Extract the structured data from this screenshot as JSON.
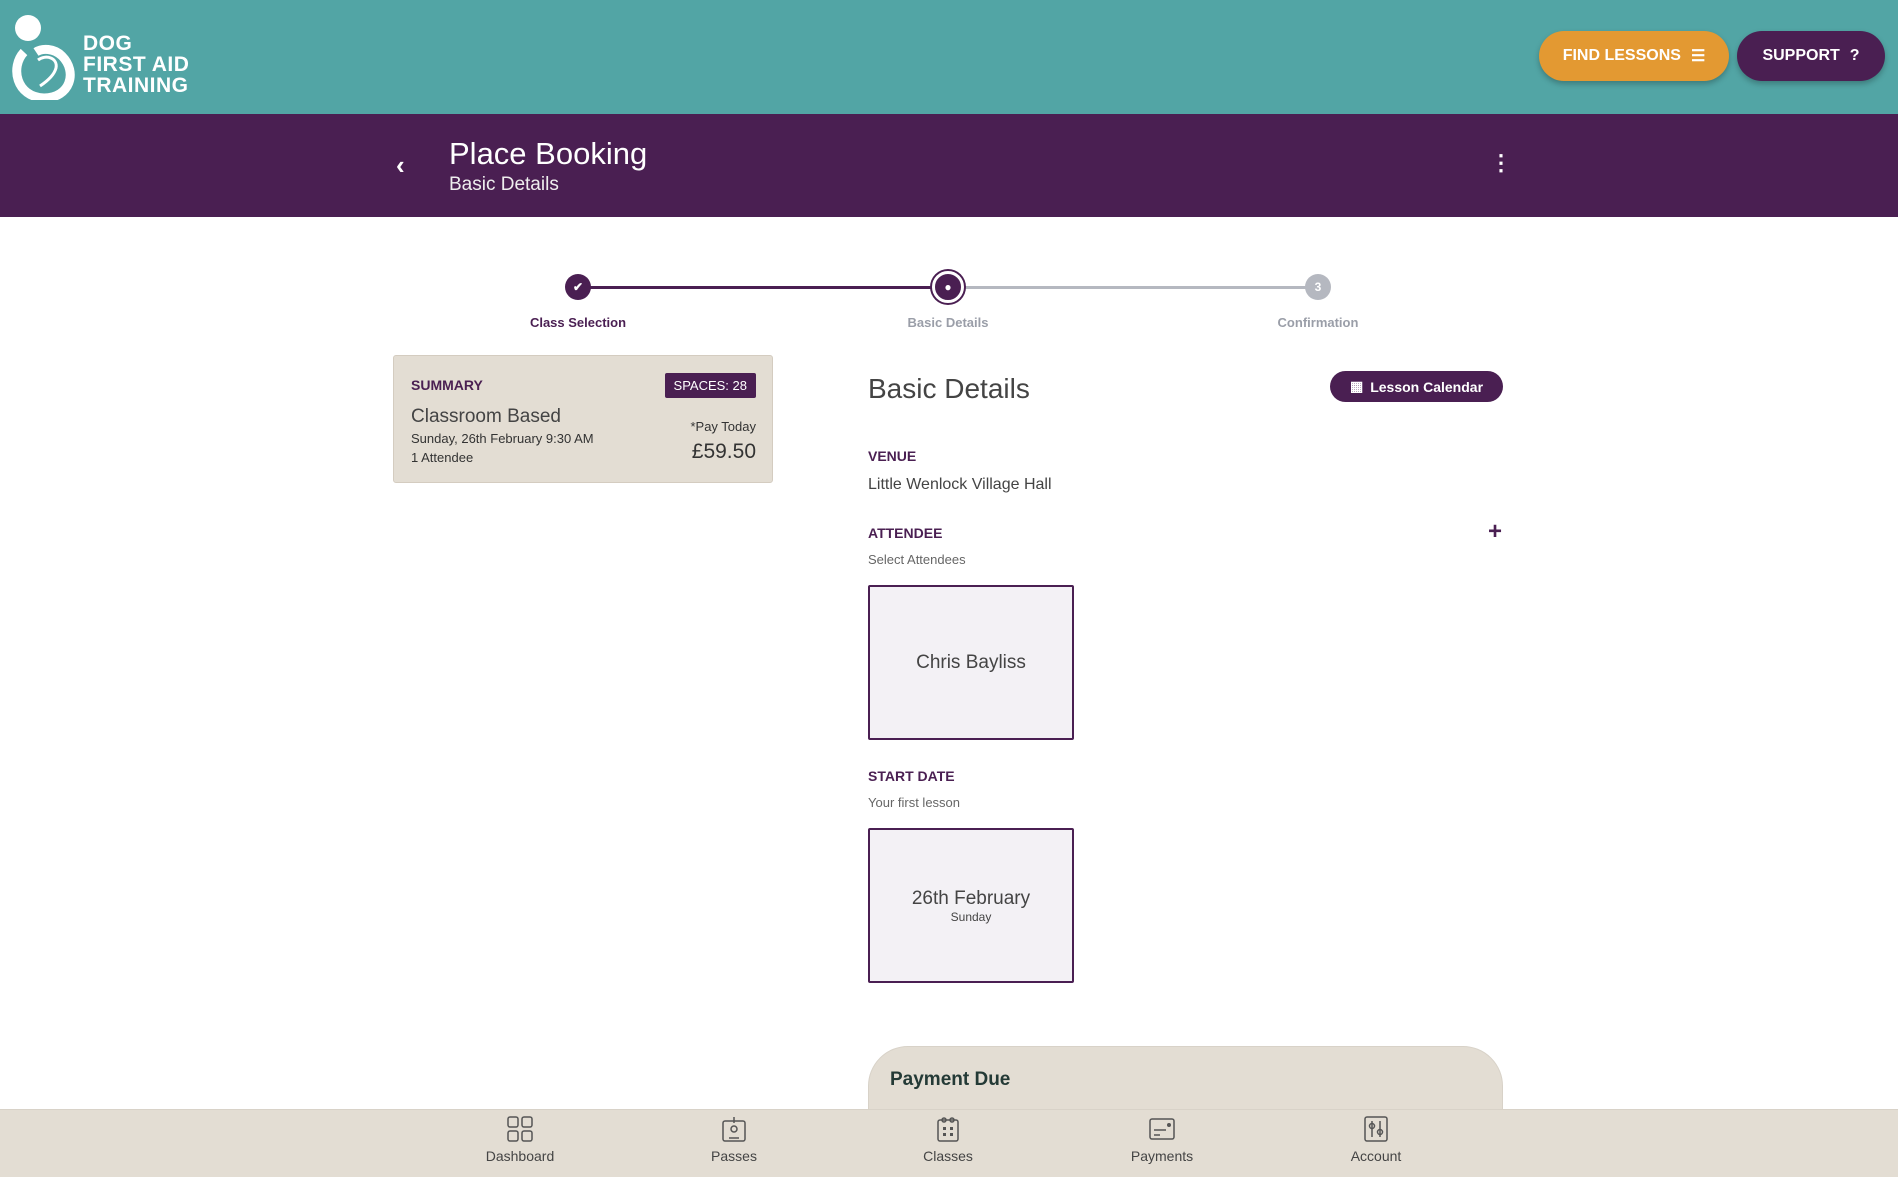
{
  "brand": {
    "logo_lines": [
      "DOG",
      "FIRST AID",
      "TRAINING"
    ]
  },
  "topbar": {
    "find_lessons": "FIND LESSONS",
    "support": "SUPPORT"
  },
  "header": {
    "title": "Place Booking",
    "subtitle": "Basic Details"
  },
  "stepper": {
    "steps": [
      {
        "label": "Class Selection",
        "state": "complete"
      },
      {
        "label": "Basic Details",
        "state": "current"
      },
      {
        "label": "Confirmation",
        "state": "pending",
        "number": "3"
      }
    ]
  },
  "summary": {
    "heading": "SUMMARY",
    "spaces": "SPACES: 28",
    "class_name": "Classroom Based",
    "datetime": "Sunday, 26th February 9:30 AM",
    "attendees": "1 Attendee",
    "pay_label": "*Pay Today",
    "price": "£59.50"
  },
  "details": {
    "heading": "Basic Details",
    "calendar_button": "Lesson Calendar",
    "venue_label": "VENUE",
    "venue": "Little Wenlock Village Hall",
    "attendee_label": "ATTENDEE",
    "attendee_hint": "Select Attendees",
    "attendee_name": "Chris Bayliss",
    "start_label": "START DATE",
    "start_hint": "Your first lesson",
    "start_date": "26th February",
    "start_day": "Sunday",
    "payment_heading": "Payment Due"
  },
  "nav": {
    "items": [
      {
        "label": "Dashboard",
        "icon": "grid-icon"
      },
      {
        "label": "Passes",
        "icon": "badge-icon"
      },
      {
        "label": "Classes",
        "icon": "calendar-icon"
      },
      {
        "label": "Payments",
        "icon": "card-icon"
      },
      {
        "label": "Account",
        "icon": "sliders-icon"
      }
    ]
  },
  "colors": {
    "teal": "#52a5a5",
    "purple": "#4a1f52",
    "orange": "#e39932",
    "beige": "#e3ddd3"
  }
}
